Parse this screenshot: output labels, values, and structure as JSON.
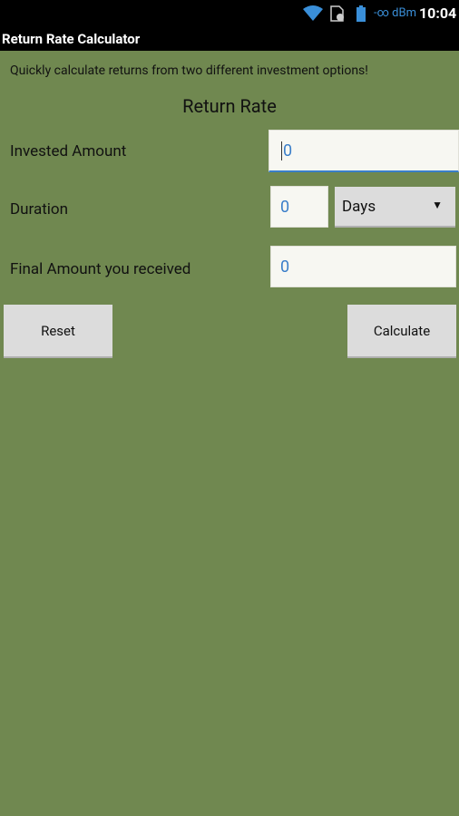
{
  "status": {
    "signal": "-∞ dBm",
    "time": "10:04",
    "icons": [
      "wifi-icon",
      "sim-icon",
      "battery-icon"
    ]
  },
  "app": {
    "title": "Return Rate Calculator"
  },
  "main": {
    "subtitle": "Quickly calculate returns from two different investment options!",
    "heading": "Return Rate",
    "invested_label": "Invested Amount",
    "invested_value": "0",
    "duration_label": "Duration",
    "duration_value": "0",
    "duration_unit": "Days",
    "final_label": "Final Amount you received",
    "final_value": "0",
    "reset": "Reset",
    "calculate": "Calculate"
  },
  "colors": {
    "background": "#708850",
    "accent": "#3a7ec9"
  }
}
